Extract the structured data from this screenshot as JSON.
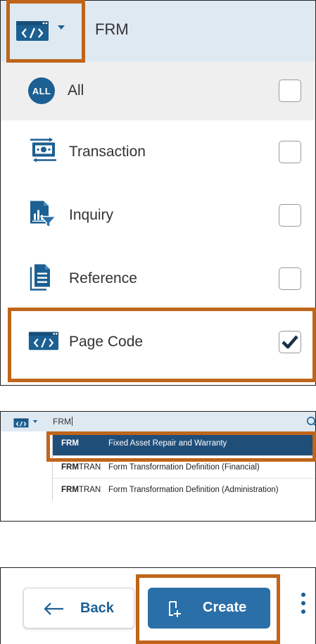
{
  "dropdown_panel": {
    "search_text": "FRM",
    "type_button_icon": "page-code-icon",
    "options": [
      {
        "label": "All",
        "icon": "all-badge",
        "badge_text": "ALL",
        "checked": false
      },
      {
        "label": "Transaction",
        "icon": "transaction-icon",
        "checked": false
      },
      {
        "label": "Inquiry",
        "icon": "inquiry-icon",
        "checked": false
      },
      {
        "label": "Reference",
        "icon": "reference-icon",
        "checked": false
      },
      {
        "label": "Page Code",
        "icon": "page-code-icon",
        "checked": true
      }
    ]
  },
  "results_panel": {
    "search_value": "FRM",
    "results": [
      {
        "code_bold": "FRM",
        "code_rest": "",
        "description": "Fixed Asset Repair and Warranty",
        "selected": true
      },
      {
        "code_bold": "FRM",
        "code_rest": "TRAN",
        "description": "Form Transformation Definition (Financial)",
        "selected": false
      },
      {
        "code_bold": "FRM",
        "code_rest": "TRAN",
        "description": "Form Transformation Definition (Administration)",
        "selected": false
      }
    ]
  },
  "action_panel": {
    "back_label": "Back",
    "create_label": "Create"
  },
  "colors": {
    "brand_blue": "#1c5f92",
    "header_bg": "#dfe9f2",
    "selected_row": "#1f4e79",
    "create_button": "#2a6fa8",
    "highlight": "#c0651a"
  }
}
